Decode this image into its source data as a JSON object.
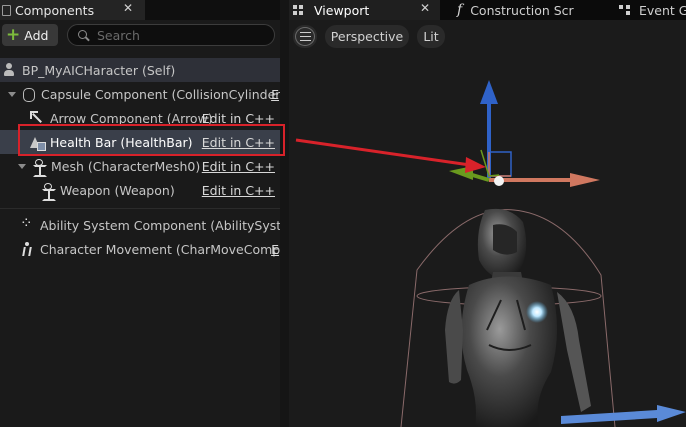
{
  "components_panel": {
    "tab_label": "Components",
    "close_glyph": "✕",
    "add_label": "Add",
    "search_placeholder": "Search",
    "tree": [
      {
        "label": "BP_MyAICHaracter (Self)",
        "icon": "pawn-icon"
      },
      {
        "label": "Capsule Component (CollisionCylinder)",
        "icon": "capsule-icon",
        "edit": "E"
      },
      {
        "label": "Arrow Component (Arrow)",
        "icon": "arrow-icon",
        "edit": "Edit in C++"
      },
      {
        "label": "Health Bar (HealthBar)",
        "icon": "widget-icon",
        "edit": "Edit in C++",
        "selected": true
      },
      {
        "label": "Mesh (CharacterMesh0)",
        "icon": "skeleton-icon",
        "edit": "Edit in C++"
      },
      {
        "label": "Weapon (Weapon)",
        "icon": "skeleton-icon",
        "edit": "Edit in C++"
      },
      {
        "label": "Ability System Component (AbilitySystem",
        "icon": "dots-icon"
      },
      {
        "label": "Character Movement (CharMoveComp)",
        "icon": "walking-icon",
        "edit": "E"
      }
    ]
  },
  "viewport_panel": {
    "tabs": [
      {
        "label": "Viewport",
        "active": true,
        "close_glyph": "✕"
      },
      {
        "label": "Construction Scr",
        "icon_glyph": "f"
      },
      {
        "label": "Event Gr"
      }
    ],
    "menu_icon": "hamburger-icon",
    "view_mode": "Perspective",
    "lighting_mode": "Lit"
  },
  "colors": {
    "gizmo_x": "#d07860",
    "gizmo_y": "#6a9a1e",
    "gizmo_z": "#2f62c8",
    "annotation": "#d8222a",
    "selection_row": "#3a3f4a"
  }
}
